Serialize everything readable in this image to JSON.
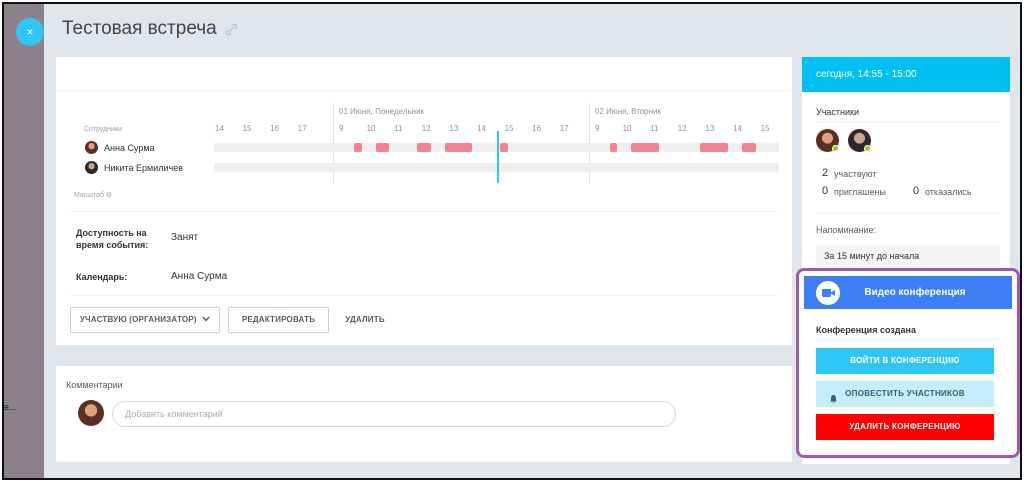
{
  "window": {
    "close_glyph": "×",
    "overflow_text": "e..."
  },
  "title": "Тестовая встреча",
  "planner": {
    "employees_label": "Сотрудники",
    "scale_label": "Масштаб ⚙",
    "day0_hours": [
      "14",
      "15",
      "16",
      "17"
    ],
    "day1_label": "01 Июня, Понедельник",
    "day1_hours": [
      "9",
      "10",
      "11",
      "12",
      "13",
      "14",
      "15",
      "16",
      "17"
    ],
    "day2_label": "02 Июня, Вторник",
    "day2_hours": [
      "9",
      "10",
      "11",
      "12",
      "13",
      "14",
      "15"
    ],
    "people": [
      "Анна Сурма",
      "Никита Ермиличев"
    ]
  },
  "details": {
    "availability_label": "Доступность на время события:",
    "availability_value": "Занят",
    "calendar_label": "Календарь:",
    "calendar_value": "Анна Сурма"
  },
  "actions": {
    "participate": "УЧАСТВУЮ (ОРГАНИЗАТОР)",
    "edit": "РЕДАКТИРОВАТЬ",
    "delete": "УДАЛИТЬ"
  },
  "comments": {
    "title": "Комментарии",
    "placeholder": "Добавить комментарий"
  },
  "sidebar": {
    "time": "сегодня, 14:55 - 15:00",
    "participants_label": "Участники",
    "attending_count": "2",
    "attending_label": "участвуют",
    "invited_count": "0",
    "invited_label": "приглашены",
    "declined_count": "0",
    "declined_label": "отказались",
    "reminder_label": "Напоминание:",
    "reminder_value": "За 15 минут до начала"
  },
  "video": {
    "title": "Видео конференция",
    "status": "Конференция создана",
    "join": "ВОЙТИ В КОНФЕРЕНЦИЮ",
    "notify": "ОПОВЕСТИТЬ УЧАСТНИКОВ",
    "remove": "УДАЛИТЬ КОНФЕРЕНЦИЮ"
  },
  "colors": {
    "accent": "#00c0f3",
    "busy": "#f2828f",
    "video": "#3d7ef7",
    "danger": "#ff0000",
    "highlight": "#9b59b6"
  },
  "icons": {
    "close": "close-icon",
    "link": "link-icon",
    "bell": "bell-icon",
    "camera": "video-camera-icon",
    "chevron": "chevron-down-icon"
  }
}
